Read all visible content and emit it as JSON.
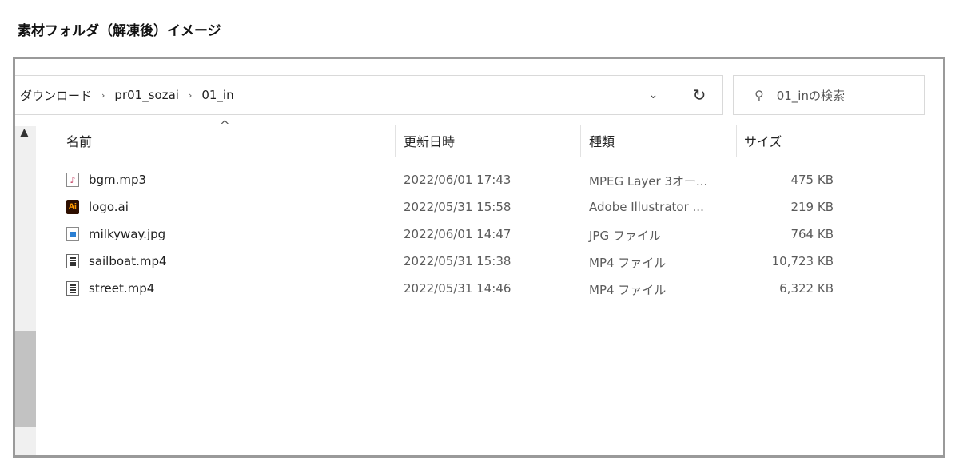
{
  "caption": "素材フォルダ（解凍後）イメージ",
  "address": {
    "crumbs": [
      "ダウンロード",
      "pr01_sozai",
      "01_in"
    ],
    "separator": "›",
    "dropdown_glyph": "⌄",
    "refresh_glyph": "↻"
  },
  "search": {
    "placeholder": "01_inの検索",
    "icon": "search-icon"
  },
  "columns": {
    "name": "名前",
    "date": "更新日時",
    "type": "種類",
    "size": "サイズ",
    "sort_glyph": "^"
  },
  "files": [
    {
      "name": "bgm.mp3",
      "date": "2022/06/01 17:43",
      "type": "MPEG Layer 3オー...",
      "size": "475 KB",
      "icon": "mp3"
    },
    {
      "name": "logo.ai",
      "date": "2022/05/31 15:58",
      "type": "Adobe Illustrator ...",
      "size": "219 KB",
      "icon": "ai"
    },
    {
      "name": "milkyway.jpg",
      "date": "2022/06/01 14:47",
      "type": "JPG ファイル",
      "size": "764 KB",
      "icon": "jpg"
    },
    {
      "name": "sailboat.mp4",
      "date": "2022/05/31 15:38",
      "type": "MP4 ファイル",
      "size": "10,723 KB",
      "icon": "mp4"
    },
    {
      "name": "street.mp4",
      "date": "2022/05/31 14:46",
      "type": "MP4 ファイル",
      "size": "6,322 KB",
      "icon": "mp4"
    }
  ]
}
